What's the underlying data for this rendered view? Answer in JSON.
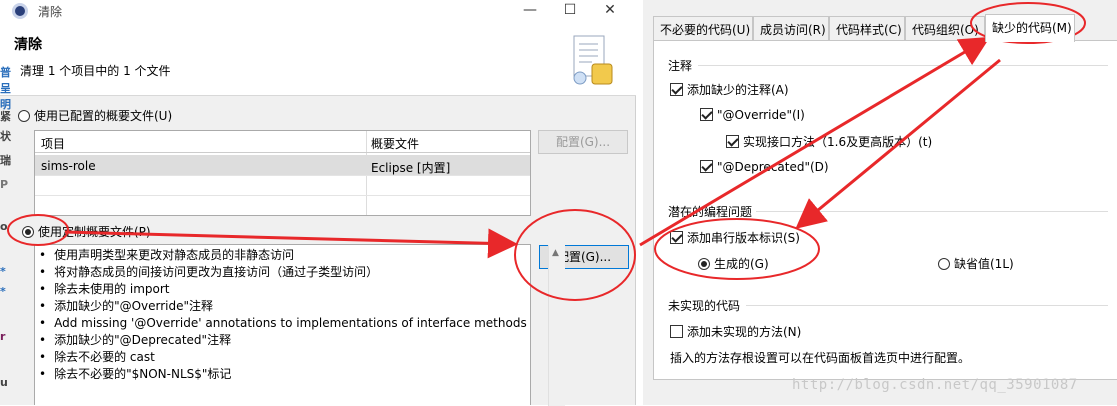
{
  "window": {
    "title": "清除",
    "minimize": "—",
    "maximize": "☐",
    "close": "✕"
  },
  "header": {
    "title": "清除",
    "subtitle": "清理 1 个项目中的 1 个文件"
  },
  "left_strip_chars": [
    "普",
    "呈",
    "明",
    "紧",
    "状",
    "瑞",
    "P",
    "o",
    "*",
    "*",
    "r",
    "u"
  ],
  "profile_options": {
    "configured_label": "使用已配置的概要文件(U)",
    "custom_label": "使用定制概要文件(P)",
    "selected": "custom"
  },
  "project_table": {
    "headers": [
      "项目",
      "概要文件"
    ],
    "rows": [
      [
        "sims-role",
        "Eclipse [内置]"
      ]
    ]
  },
  "buttons": {
    "configure_disabled": "配置(G)...",
    "configure_enabled": "配置(G)..."
  },
  "actions": [
    "使用声明类型来更改对静态成员的非静态访问",
    "将对静态成员的间接访问更改为直接访问（通过子类型访问）",
    "除去未使用的 import",
    "添加缺少的\"@Override\"注释",
    "Add missing '@Override' annotations to implementations of interface methods",
    "添加缺少的\"@Deprecated\"注释",
    "除去不必要的 cast",
    "除去不必要的\"$NON-NLS$\"标记"
  ],
  "tabs": [
    {
      "label": "不必要的代码(U)",
      "active": false
    },
    {
      "label": "成员访问(R)",
      "active": false
    },
    {
      "label": "代码样式(C)",
      "active": false
    },
    {
      "label": "代码组织(O)",
      "active": false
    },
    {
      "label": "缺少的代码(M)",
      "active": true
    }
  ],
  "annotations_group": {
    "title": "注释",
    "add_missing": {
      "label": "添加缺少的注释(A)",
      "checked": true
    },
    "override": {
      "label": "\"@Override\"(I)",
      "checked": true
    },
    "impl_interface": {
      "label": "实现接口方法（1.6及更高版本）(t)",
      "checked": true
    },
    "deprecated": {
      "label": "\"@Deprecated\"(D)",
      "checked": true
    }
  },
  "potential_group": {
    "title": "潜在的编程问题",
    "add_serial": {
      "label": "添加串行版本标识(S)",
      "checked": true
    },
    "generated": {
      "label": "生成的(G)",
      "selected": true
    },
    "default": {
      "label": "缺省值(1L)",
      "selected": false
    }
  },
  "unimplemented_group": {
    "title": "未实现的代码",
    "add_unimpl": {
      "label": "添加未实现的方法(N)",
      "checked": false
    },
    "note": "插入的方法存根设置可以在代码面板首选页中进行配置。"
  },
  "watermark": "http://blog.csdn.net/qq_35901087",
  "annotation_color": "#e8282a"
}
